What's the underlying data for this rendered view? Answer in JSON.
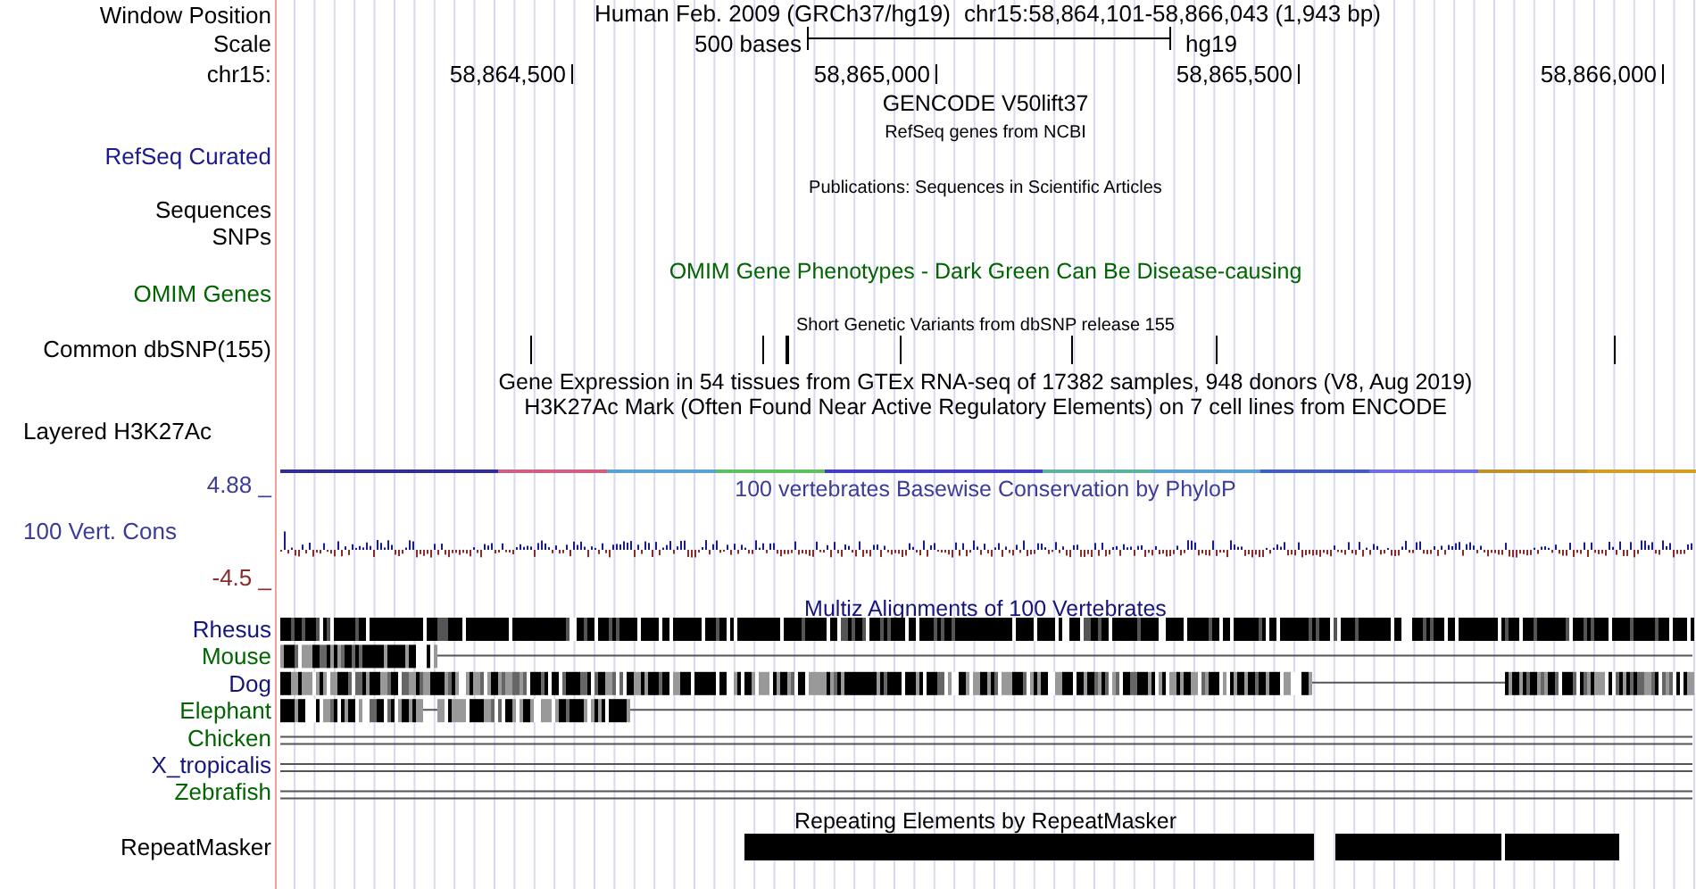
{
  "header": {
    "label": "Window Position",
    "assembly": "Human Feb. 2009 (GRCh37/hg19)",
    "position": "chr15:58,864,101-58,866,043 (1,943 bp)"
  },
  "scale": {
    "label": "Scale",
    "bar_label": "500 bases",
    "db": "hg19"
  },
  "ruler": {
    "chrom": "chr15:",
    "ticks": [
      "58,864,500",
      "58,865,000",
      "58,865,500",
      "58,866,000"
    ]
  },
  "track_titles": [
    {
      "text": "GENCODE V50lift37",
      "kind": "main",
      "color": "#000000"
    },
    {
      "text": "RefSeq genes from NCBI",
      "kind": "small",
      "color": "#000000"
    },
    {
      "text": "Publications: Sequences in Scientific Articles",
      "kind": "small",
      "color": "#000000"
    },
    {
      "text": "OMIM Gene Phenotypes - Dark Green Can Be Disease-causing",
      "kind": "main",
      "color": "#006400"
    },
    {
      "text": "Short Genetic Variants from dbSNP release 155",
      "kind": "small",
      "color": "#000000"
    },
    {
      "text": "Gene Expression in 54 tissues from GTEx RNA-seq of 17382 samples, 948 donors (V8, Aug 2019)",
      "kind": "main",
      "color": "#000000"
    },
    {
      "text": "H3K27Ac Mark (Often Found Near Active Regulatory Elements) on 7 cell lines from ENCODE",
      "kind": "main",
      "color": "#000000"
    },
    {
      "text": "100 vertebrates Basewise Conservation by PhyloP",
      "kind": "main",
      "color": "#3c3c96"
    },
    {
      "text": "Multiz Alignments of 100 Vertebrates",
      "kind": "main",
      "color": "#14147a"
    },
    {
      "text": "Repeating Elements by RepeatMasker",
      "kind": "main",
      "color": "#000000"
    }
  ],
  "track_labels": [
    {
      "text": "RefSeq Curated",
      "color": "#1a1a8c"
    },
    {
      "text": "Sequences",
      "color": "#000000"
    },
    {
      "text": "SNPs",
      "color": "#000000"
    },
    {
      "text": "OMIM Genes",
      "color": "#006400"
    },
    {
      "text": "Common dbSNP(155)",
      "color": "#000000"
    },
    {
      "text": "Layered H3K27Ac",
      "color": "#000000"
    },
    {
      "text": "100 Vert. Cons",
      "color": "#3c3c96"
    },
    {
      "text": "RepeatMasker",
      "color": "#000000"
    }
  ],
  "conservation": {
    "max": "4.88 _",
    "min": "-4.5 _"
  },
  "species": [
    {
      "name": "Rhesus",
      "color": "#14147a"
    },
    {
      "name": "Mouse",
      "color": "#006400"
    },
    {
      "name": "Dog",
      "color": "#14147a"
    },
    {
      "name": "Elephant",
      "color": "#006400"
    },
    {
      "name": "Chicken",
      "color": "#006400"
    },
    {
      "name": "X_tropicalis",
      "color": "#14147a"
    },
    {
      "name": "Zebrafish",
      "color": "#006400"
    }
  ]
}
